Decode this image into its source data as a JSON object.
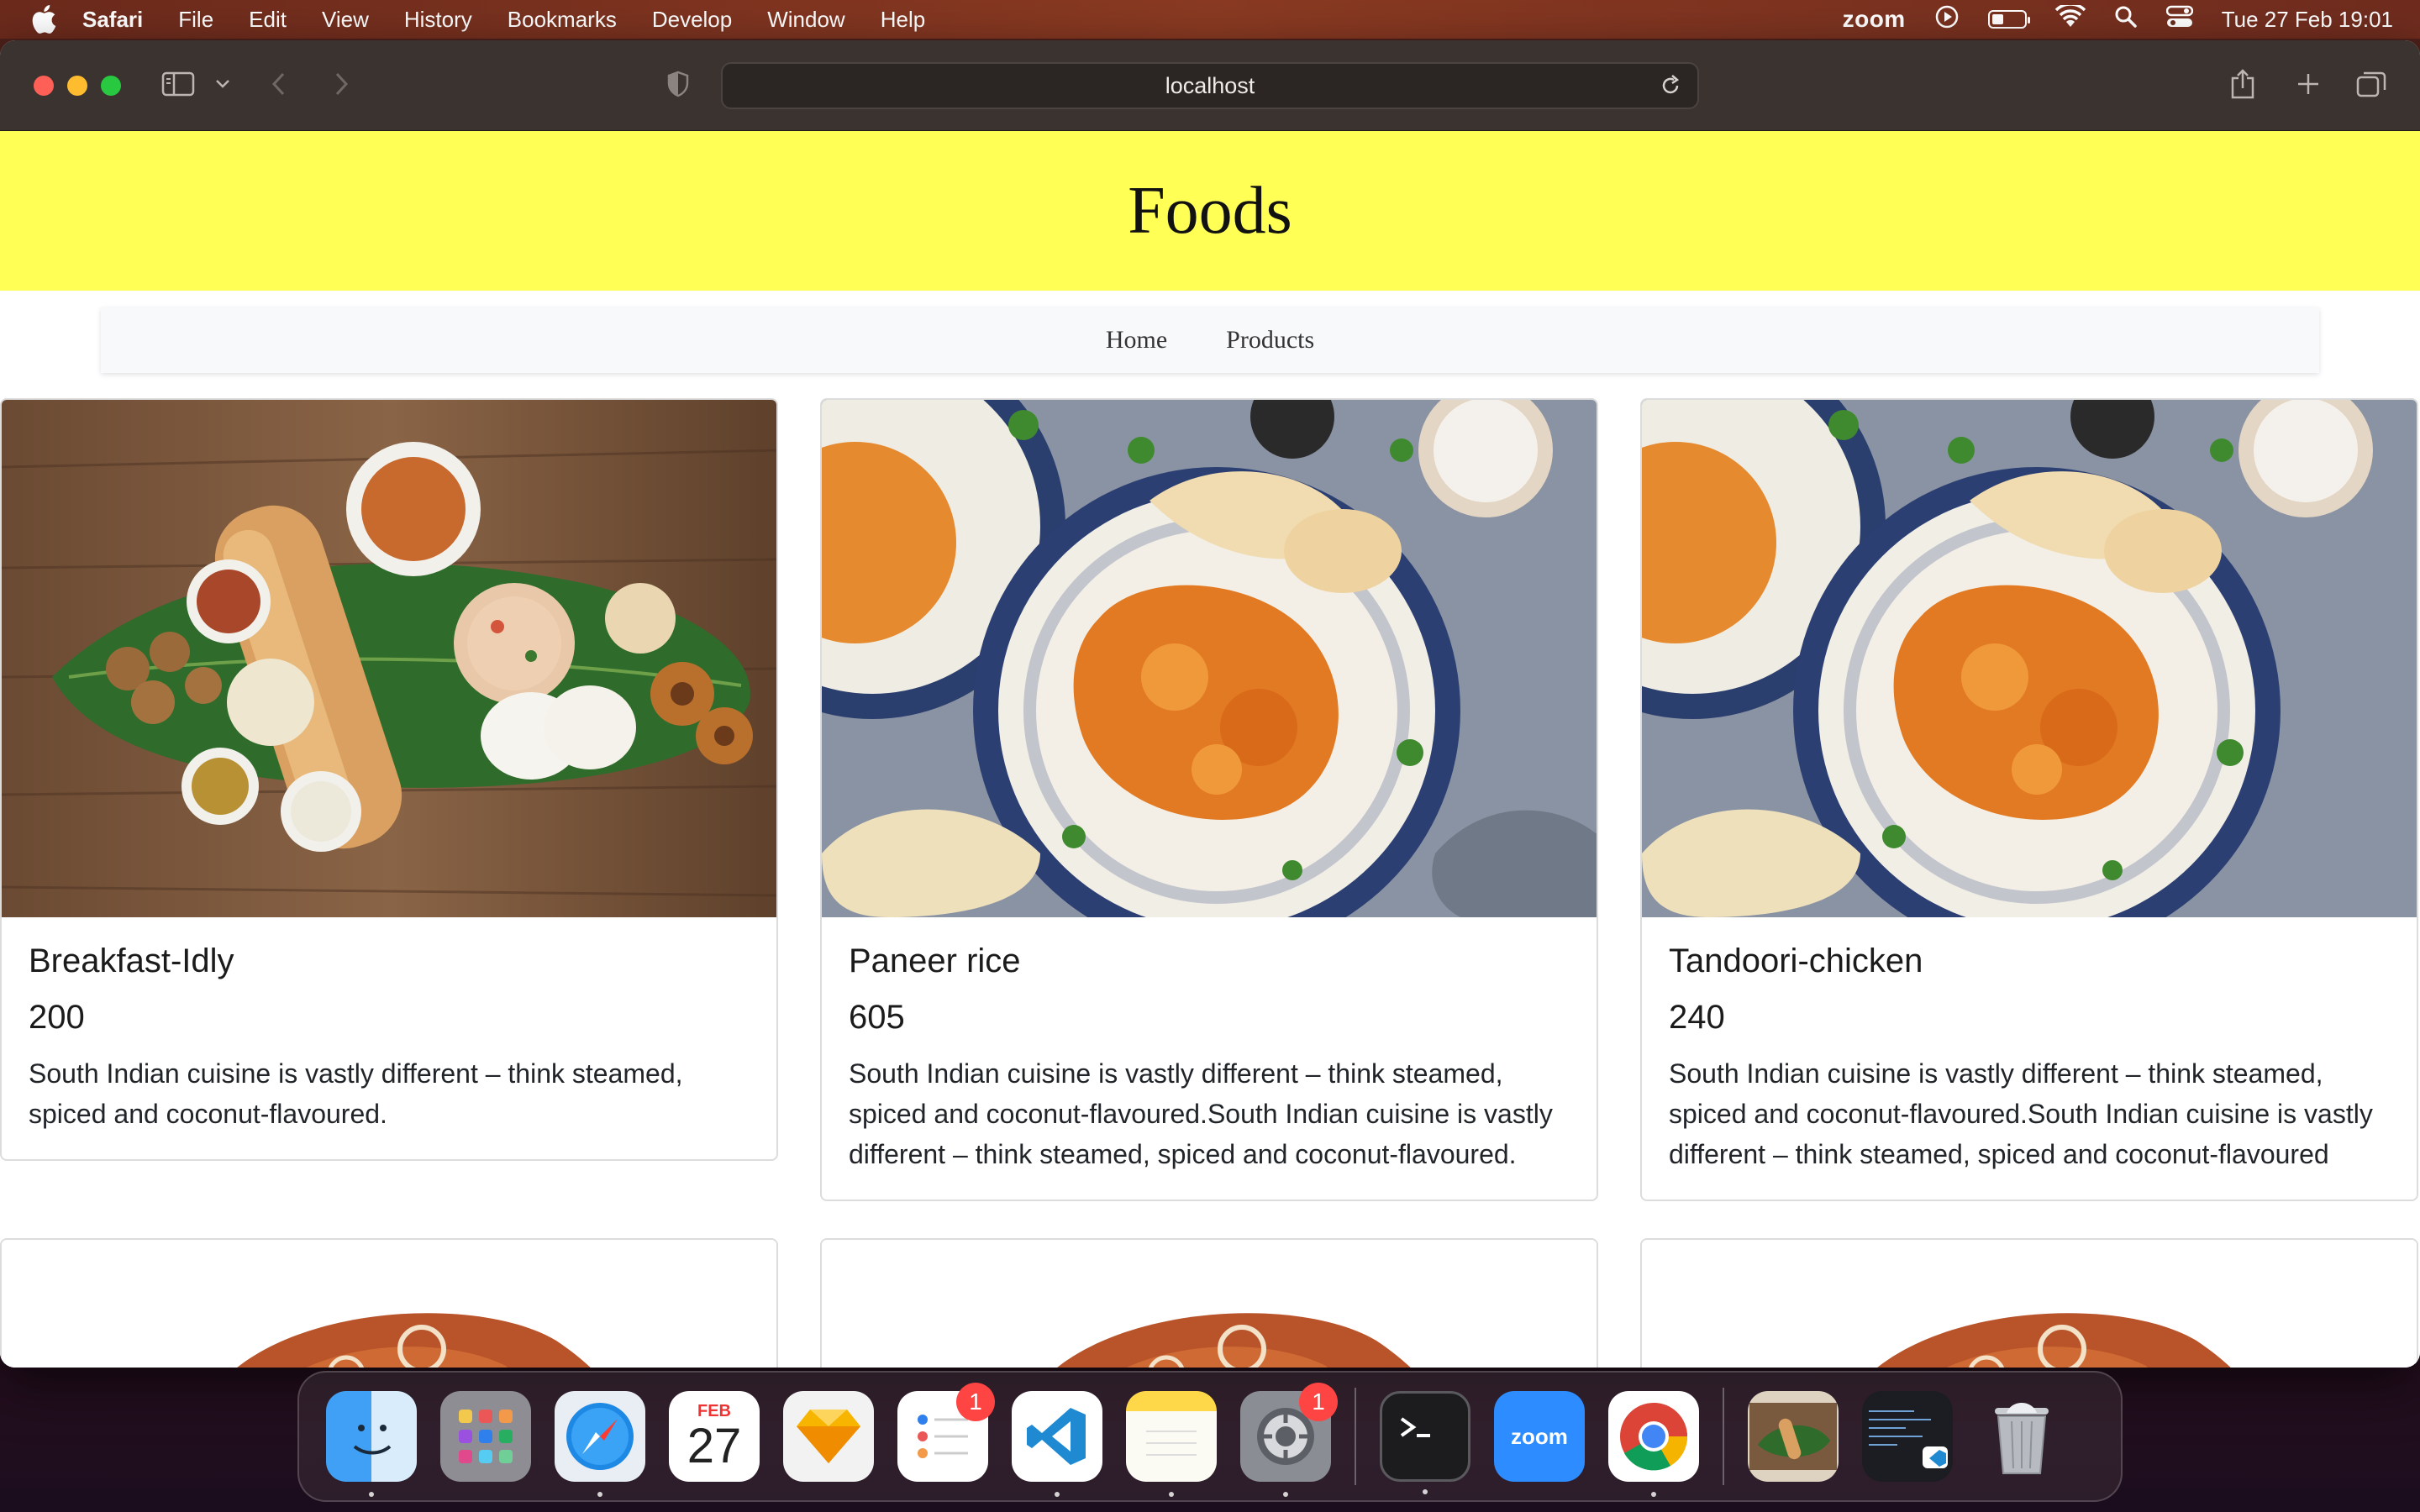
{
  "menubar": {
    "app": "Safari",
    "items": [
      "File",
      "Edit",
      "View",
      "History",
      "Bookmarks",
      "Develop",
      "Window",
      "Help"
    ],
    "zoom_label": "zoom",
    "datetime": "Tue 27 Feb  19:01",
    "battery_level": 0.35
  },
  "browser": {
    "address": "localhost"
  },
  "page": {
    "heading": "Foods",
    "nav": [
      "Home",
      "Products"
    ],
    "products": [
      {
        "title": "Breakfast-Idly",
        "price": "200",
        "description": "South Indian cuisine is vastly different – think steamed, spiced and coconut-flavoured."
      },
      {
        "title": "Paneer rice",
        "price": "605",
        "description": "South Indian cuisine is vastly different – think steamed, spiced and coconut-flavoured.South Indian cuisine is vastly different – think steamed, spiced and coconut-flavoured."
      },
      {
        "title": "Tandoori-chicken",
        "price": "240",
        "description": "South Indian cuisine is vastly different – think steamed, spiced and coconut-flavoured.South Indian cuisine is vastly different – think steamed, spiced and coconut-flavoured"
      }
    ]
  },
  "dock": {
    "calendar_month": "FEB",
    "calendar_day": "27",
    "reminders_badge": "1",
    "settings_badge": "1",
    "zoom_label": "zoom"
  }
}
